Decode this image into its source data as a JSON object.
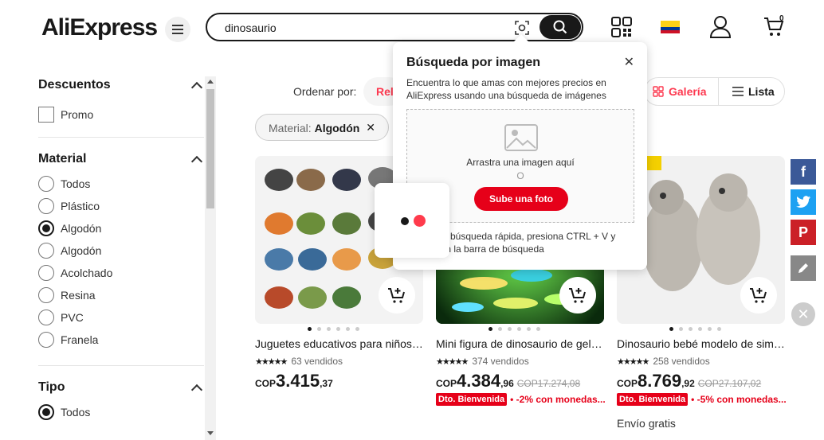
{
  "header": {
    "logo": "AliExpress",
    "search_value": "dinosaurio",
    "cart_count": "0",
    "country_flag": "Colombia"
  },
  "filters": {
    "descuentos": {
      "title": "Descuentos",
      "options": [
        "Promo"
      ]
    },
    "material": {
      "title": "Material",
      "options": [
        "Todos",
        "Plástico",
        "Algodón",
        "Algodón",
        "Acolchado",
        "Resina",
        "PVC",
        "Franela"
      ],
      "selected_index": 2
    },
    "tipo": {
      "title": "Tipo",
      "options": [
        "Todos"
      ],
      "selected_index": 0
    }
  },
  "sort": {
    "label": "Ordenar por:",
    "active": "Rel",
    "view_gallery": "Galería",
    "view_list": "Lista"
  },
  "chip": {
    "key": "Material:",
    "value": "Algodón",
    "close": "✕"
  },
  "popup": {
    "title": "Búsqueda por imagen",
    "close": "✕",
    "description": "Encuentra lo que amas con mejores precios en AliExpress usando una búsqueda de imágenes",
    "drag_text": "Arrastra una imagen aquí",
    "or_text": "O",
    "upload_button": "Sube una foto",
    "hint": "búsqueda rápida, presiona CTRL + V y imagen en la barra de búsqueda"
  },
  "products": [
    {
      "title": "Juguetes educativos para niños de dinosaurio",
      "stars": "★★★★★",
      "sold": "63 vendidos",
      "currency": "COP",
      "price_int": "3.415",
      "price_dec": ",37",
      "old_price": "",
      "tag": "",
      "promo": "",
      "shipping": ""
    },
    {
      "title": "Mini figura de dinosaurio de gel brillante",
      "stars": "★★★★★",
      "sold": "374 vendidos",
      "currency": "COP",
      "price_int": "4.384",
      "price_dec": ",96",
      "old_price": "COP17.274,08",
      "tag": "Dto. Bienvenida",
      "promo": "• -2% con monedas...",
      "shipping": ""
    },
    {
      "title": "Dinosaurio bebé modelo de simulación",
      "stars": "★★★★★",
      "sold": "258 vendidos",
      "currency": "COP",
      "price_int": "8.769",
      "price_dec": ",92",
      "old_price": "COP27.107,02",
      "tag": "Dto. Bienvenida",
      "promo": "• -5% con monedas...",
      "shipping": "Envío gratis"
    }
  ],
  "share": {
    "facebook": "f",
    "pinterest": "P",
    "close": "✕"
  },
  "colors": {
    "accent": "#fd384f",
    "promo_red": "#e60019",
    "facebook": "#3b5998",
    "twitter": "#1da1f2",
    "pinterest": "#cb2027",
    "edit": "#888888"
  }
}
